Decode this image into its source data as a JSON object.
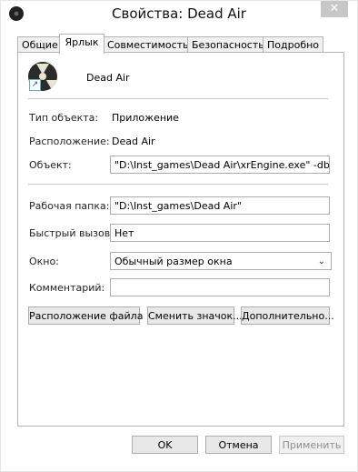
{
  "window": {
    "title": "Свойства: Dead Air",
    "close_glyph": "✕"
  },
  "tabs": [
    {
      "label": "Общие"
    },
    {
      "label": "Ярлык"
    },
    {
      "label": "Совместимость"
    },
    {
      "label": "Безопасность"
    },
    {
      "label": "Подробно"
    }
  ],
  "active_tab": "Ярлык",
  "shortcut": {
    "name": "Dead Air",
    "type_label": "Тип объекта:",
    "type_value": "Приложение",
    "location_label": "Расположение:",
    "location_value": "Dead Air",
    "target_label": "Объект:",
    "target_value": "\"D:\\Inst_games\\Dead Air\\xrEngine.exe\" -dbg",
    "workdir_label": "Рабочая папка:",
    "workdir_value": "\"D:\\Inst_games\\Dead Air\"",
    "hotkey_label": "Быстрый вызов:",
    "hotkey_value": "Нет",
    "run_label": "Окно:",
    "run_value": "Обычный размер окна",
    "comment_label": "Комментарий:",
    "comment_value": ""
  },
  "actions": {
    "open_location": "Расположение файла",
    "change_icon": "Сменить значок...",
    "advanced": "Дополнительно..."
  },
  "footer": {
    "ok": "OK",
    "cancel": "Отмена",
    "apply": "Применить"
  },
  "icons": {
    "app": "radiation-icon",
    "shortcut_overlay": "shortcut-arrow-icon",
    "dropdown": "chevron-down-icon"
  }
}
